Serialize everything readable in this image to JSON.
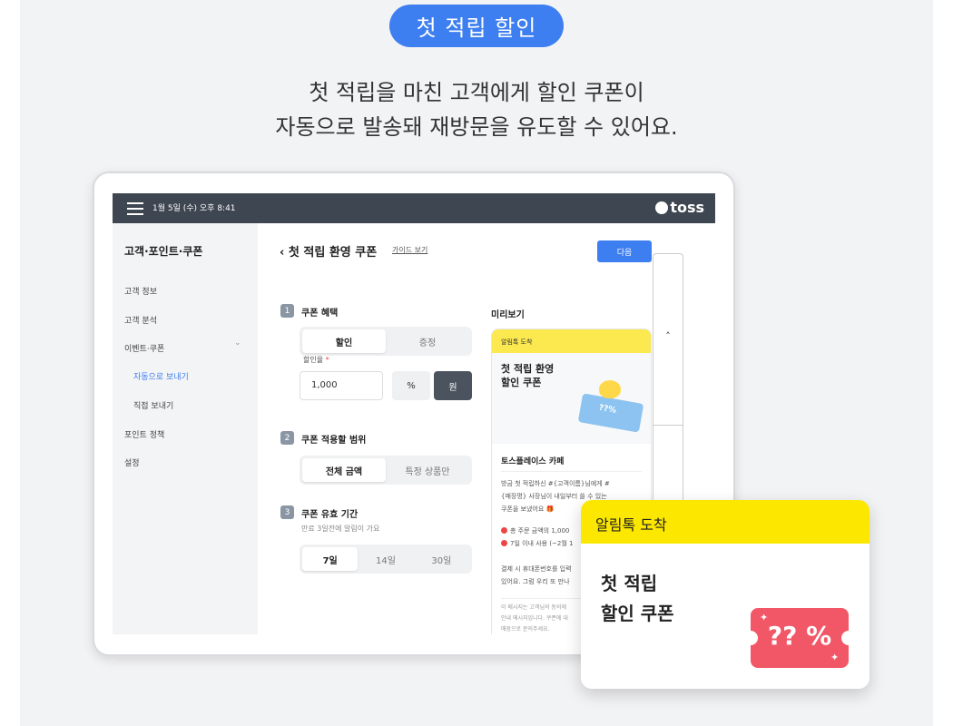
{
  "badge": "첫 적립 할인",
  "headline": {
    "line1": "첫 적립을 마친 고객에게 할인 쿠폰이",
    "line2": "자동으로 발송돼 재방문을 유도할 수 있어요."
  },
  "topbar": {
    "datetime": "1월 5일 (수) 오후 8:41",
    "brand": "toss"
  },
  "sidebar": {
    "title": "고객·포인트·쿠폰",
    "items": [
      {
        "label": "고객 정보"
      },
      {
        "label": "고객 분석"
      },
      {
        "label": "이벤트·쿠폰"
      },
      {
        "label": "자동으로 보내기"
      },
      {
        "label": "직접 보내기"
      },
      {
        "label": "포인트 정책"
      },
      {
        "label": "설정"
      }
    ]
  },
  "main": {
    "back_title": "첫 적립 환영 쿠폰",
    "guide_link": "가이드 보기",
    "next_button": "다음",
    "section1": {
      "num": "1",
      "title": "쿠폰 혜택",
      "tabs": [
        "할인",
        "증정"
      ],
      "discount_label": "할인율",
      "discount_value": "1,000",
      "unit_percent": "%",
      "unit_won": "원"
    },
    "section2": {
      "num": "2",
      "title": "쿠폰 적용할 범위",
      "tabs": [
        "전체 금액",
        "특정 상품만"
      ]
    },
    "section3": {
      "num": "3",
      "title": "쿠폰 유효 기간",
      "hint": "만료 3일전에 알림이 가요",
      "tabs": [
        "7일",
        "14일",
        "30일"
      ]
    }
  },
  "preview": {
    "title": "미리보기",
    "header": "알림톡 도착",
    "coupon_line1": "첫 적립 환영",
    "coupon_line2": "할인 쿠폰",
    "ticket_text": "??%",
    "shop": "토스플레이스 카페",
    "msg1": "방금 첫 적립하신 #{고객이름}님에게 #",
    "msg2": "{매장명} 사장님이 내일부터 쓸 수 있는",
    "msg3": "쿠폰을 보냈어요 🎁",
    "cond1": "총 주문 금액의 1,000",
    "cond2": "7일 이내 사용 (~2월 1",
    "pay1": "결제 시 휴대폰번호를 입력",
    "pay2": "있어요. 그럼 우리 또 만나",
    "fine1": "이 메시지는 고객님의 동의에",
    "fine2": "안내 메시지입니다. 쿠폰에 대",
    "fine3": "매장으로 문의주세요."
  },
  "scroll_arrow": "˄",
  "popup": {
    "header": "알림톡 도착",
    "line1": "첫 적립",
    "line2": "할인 쿠폰",
    "ticket_text": "?? %"
  }
}
